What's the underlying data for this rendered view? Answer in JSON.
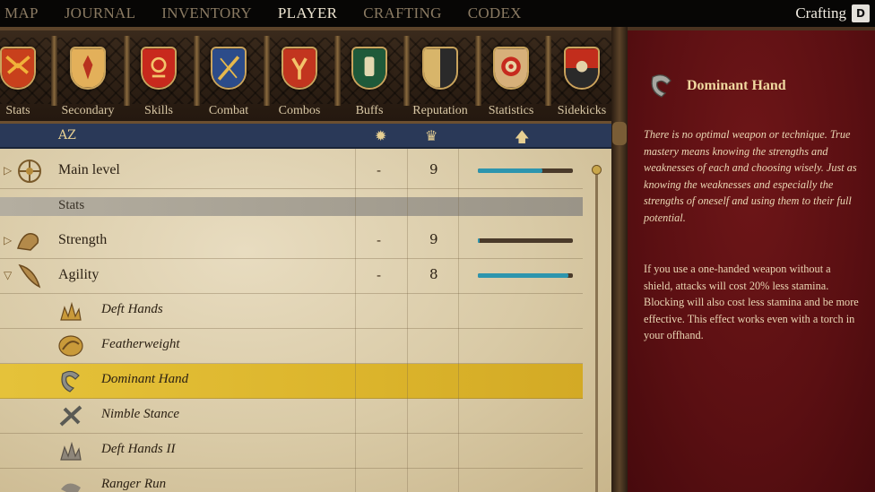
{
  "top_nav": {
    "items": [
      "MAP",
      "JOURNAL",
      "INVENTORY",
      "PLAYER",
      "CRAFTING",
      "CODEX"
    ],
    "active": "PLAYER"
  },
  "crafting_indicator": {
    "label": "Crafting",
    "key": "D"
  },
  "categories": [
    "Stats",
    "Secondary",
    "Skills",
    "Combat",
    "Combos",
    "Buffs",
    "Reputation",
    "Statistics",
    "Sidekicks"
  ],
  "table_header": {
    "sort_glyph": "AZ"
  },
  "rows": {
    "main_level": {
      "name": "Main level",
      "modifier": "-",
      "value": "9",
      "progress": 0.68
    },
    "section_stats": "Stats",
    "strength": {
      "name": "Strength",
      "modifier": "-",
      "value": "9",
      "progress": 0.02
    },
    "agility": {
      "name": "Agility",
      "modifier": "-",
      "value": "8",
      "progress": 0.95
    },
    "perks": [
      "Deft Hands",
      "Featherweight",
      "Dominant Hand",
      "Nimble Stance",
      "Deft Hands II",
      "Ranger Run"
    ],
    "selected_perk": "Dominant Hand"
  },
  "detail": {
    "title": "Dominant Hand",
    "quote": "There is no optimal weapon or technique. True mastery means knowing the strengths and weaknesses of each and choosing wisely. Just as knowing the weaknesses and especially the strengths of oneself and using them to their full potential.",
    "body": "If you use a one-handed weapon without a shield, attacks will cost 20% less stamina. Blocking will also cost less stamina and be more effective. This effect works even with a torch in your offhand."
  },
  "colors": {
    "accent_gold": "#e5c23a",
    "detail_red": "#5a0f12",
    "progress_blue": "#2d95ae",
    "header_blue": "#2a3958"
  }
}
